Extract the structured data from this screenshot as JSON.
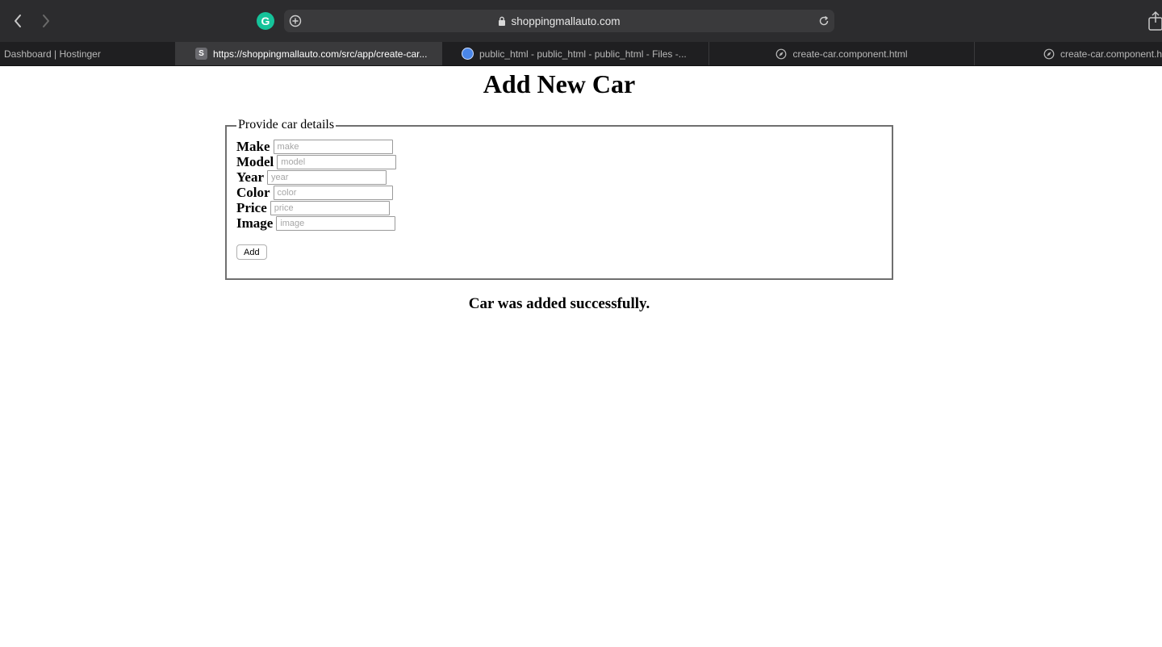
{
  "browser": {
    "address_text": "shoppingmallauto.com",
    "extension_letter": "G",
    "tabs": [
      {
        "title": "Dashboard | Hostinger",
        "active": false,
        "icon": "none"
      },
      {
        "title": "https://shoppingmallauto.com/src/app/create-car...",
        "active": true,
        "icon": "s-favicon",
        "favicon_letter": "S"
      },
      {
        "title": "public_html - public_html - public_html - Files -...",
        "active": false,
        "icon": "globe-favicon"
      },
      {
        "title": "create-car.component.html",
        "active": false,
        "icon": "compass-icon"
      },
      {
        "title": "create-car.component.ht",
        "active": false,
        "icon": "compass-icon"
      }
    ]
  },
  "page": {
    "title": "Add New Car",
    "legend": "Provide car details",
    "fields": [
      {
        "label": "Make",
        "placeholder": "make"
      },
      {
        "label": "Model",
        "placeholder": "model"
      },
      {
        "label": "Year",
        "placeholder": "year"
      },
      {
        "label": "Color",
        "placeholder": "color"
      },
      {
        "label": "Price",
        "placeholder": "price"
      },
      {
        "label": "Image",
        "placeholder": "image"
      }
    ],
    "add_button": "Add",
    "success_message": "Car was added successfully."
  }
}
